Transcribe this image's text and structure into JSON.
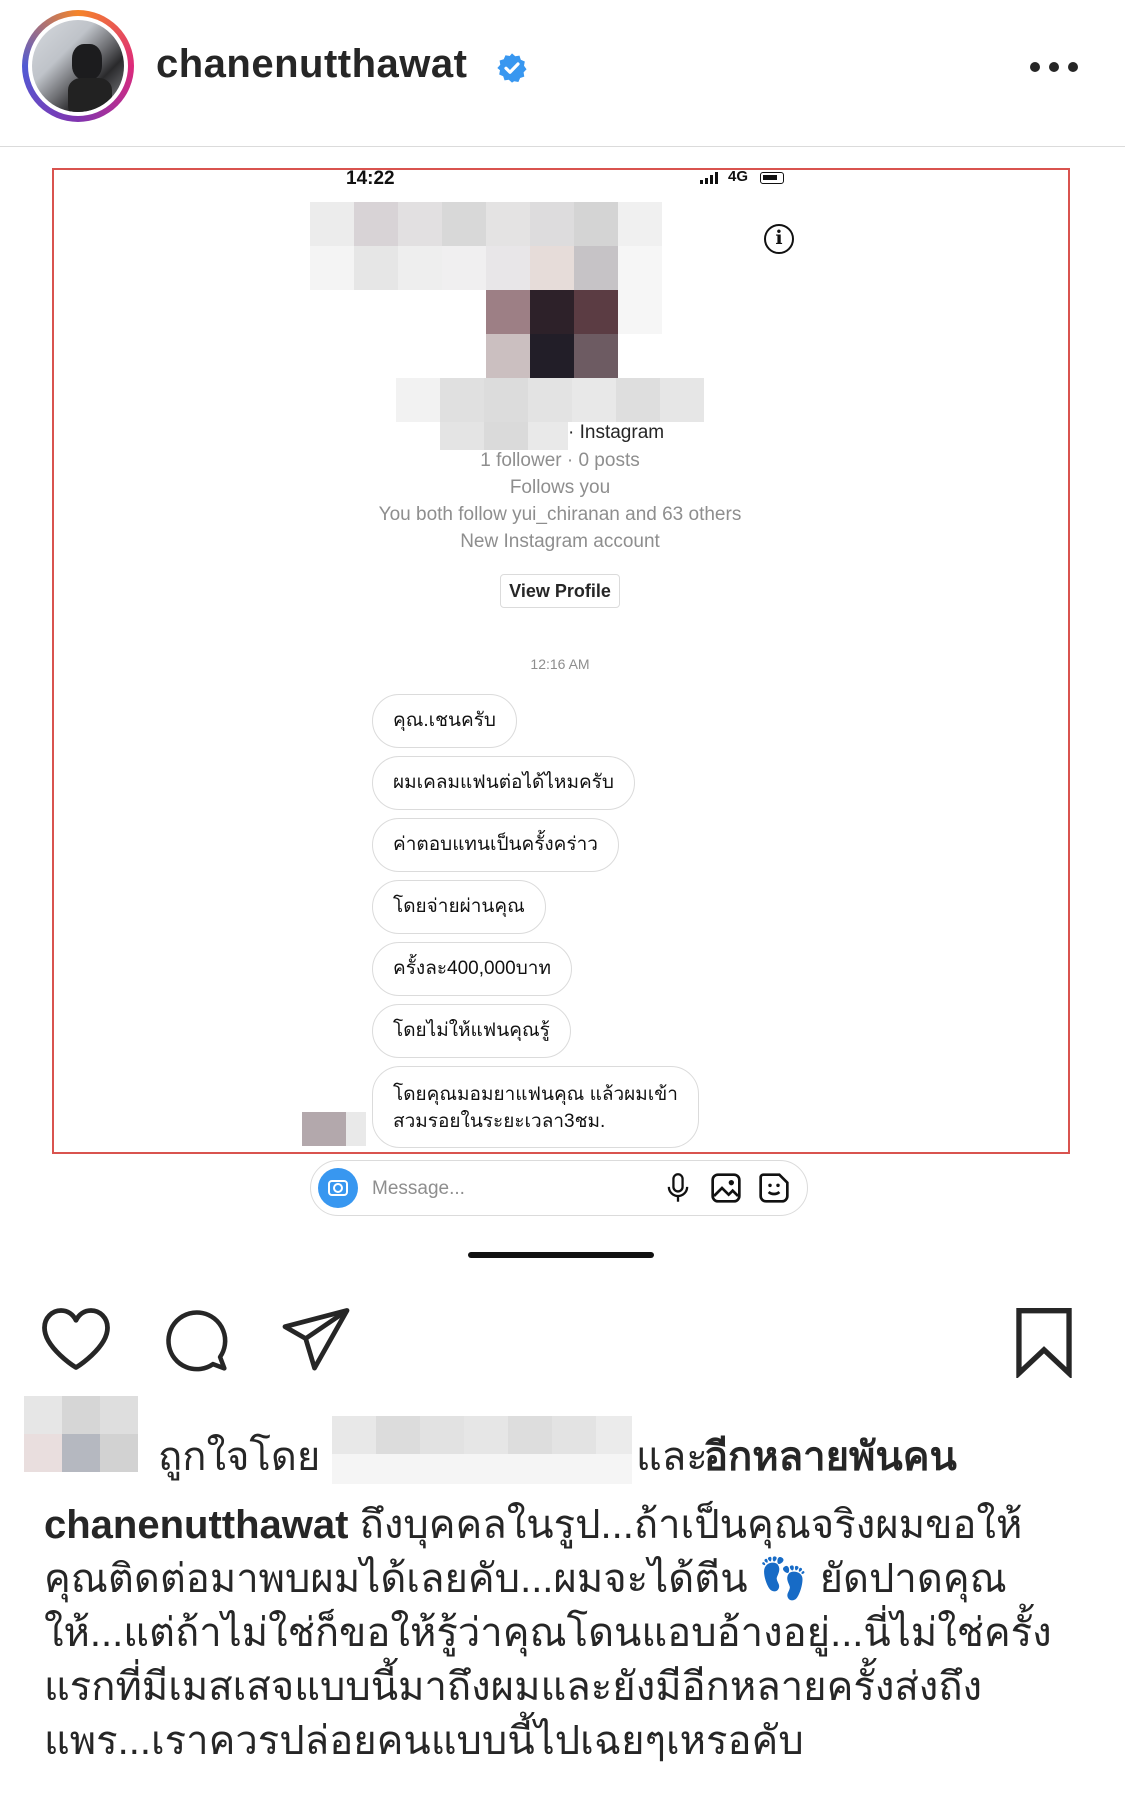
{
  "header": {
    "username": "chanenutthawat",
    "verified": true,
    "more_icon": "more-horizontal-icon"
  },
  "screenshot": {
    "status": {
      "time": "14:22",
      "network": "4G"
    },
    "profile": {
      "platform": "· Instagram",
      "stats": "1 follower · 0 posts",
      "follows_you": "Follows you",
      "mutual": "You both follow yui_chiranan and 63 others",
      "account_note": "New Instagram account",
      "view_profile_label": "View Profile"
    },
    "message_time": "12:16 AM",
    "messages": [
      "คุณ.เชนครับ",
      "ผมเคลมแฟนต่อได้ไหมครับ",
      "ค่าตอบแทนเป็นครั้งคร่าว",
      "โดยจ่ายผ่านคุณ",
      "ครั้งละ400,000บาท",
      "โดยไม่ให้แฟนคุณรู้",
      "โดยคุณมอมยาแฟนคุณ แล้วผมเข้า",
      "สวมรอยในระยะเวลา3ชม."
    ],
    "message_placeholder": "Message..."
  },
  "actions": {
    "like": "heart-icon",
    "comment": "comment-icon",
    "share": "paper-plane-icon",
    "save": "bookmark-icon"
  },
  "likes": {
    "liked_by": "ถูกใจโดย",
    "and": "และ",
    "others": "อีกหลายพันคน"
  },
  "caption": {
    "username": "chanenutthawat",
    "text_part1": " ถึงบุคคลในรูป...ถ้าเป็นคุณจริงผมขอให้คุณติดต่อมาพบผมได้เลยคับ...ผมจะได้ตีน ",
    "emoji": "👣",
    "text_part2": " ยัดปาดคุณให้...แต่ถ้าไม่ใช่ก็ขอให้รู้ว่าคุณโดนแอบอ้างอยู่...นี่ไม่ใช่ครั้งแรกที่มีเมสเสจแบบนี้มาถึงผมและยังมีอีกหลายครั้งส่งถึงแพร...เราควรปล่อยคนแบบนี้ไปเฉยๆเหรอคับ"
  }
}
